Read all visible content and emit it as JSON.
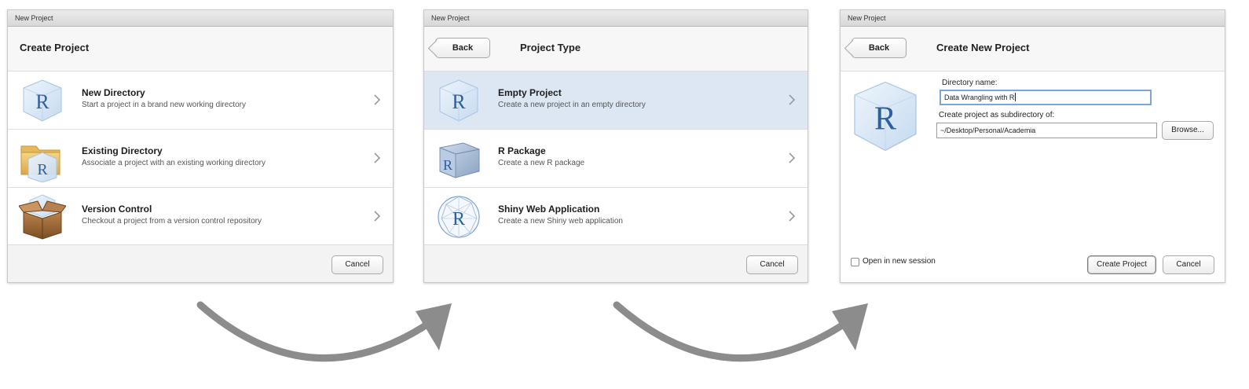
{
  "panel1": {
    "window_title": "New Project",
    "header_title": "Create Project",
    "options": [
      {
        "title": "New Directory",
        "desc": "Start a project in a brand new working directory",
        "icon": "r-cube-icon"
      },
      {
        "title": "Existing Directory",
        "desc": "Associate a project with an existing working directory",
        "icon": "folder-r-icon"
      },
      {
        "title": "Version Control",
        "desc": "Checkout a project from a version control repository",
        "icon": "box-icon"
      }
    ],
    "cancel_label": "Cancel"
  },
  "panel2": {
    "window_title": "New Project",
    "back_label": "Back",
    "header_title": "Project Type",
    "options": [
      {
        "title": "Empty Project",
        "desc": "Create a new project in an empty directory",
        "icon": "r-cube-icon",
        "selected": true
      },
      {
        "title": "R Package",
        "desc": "Create a new R package",
        "icon": "r-package-icon"
      },
      {
        "title": "Shiny Web Application",
        "desc": "Create a new Shiny web application",
        "icon": "shiny-globe-icon"
      }
    ],
    "cancel_label": "Cancel"
  },
  "panel3": {
    "window_title": "New Project",
    "back_label": "Back",
    "header_title": "Create New Project",
    "directory_name_label": "Directory name:",
    "directory_name_value": "Data Wrangling with R",
    "subdirectory_label": "Create project as subdirectory of:",
    "subdirectory_value": "~/Desktop/Personal/Academia",
    "browse_label": "Browse...",
    "open_new_session_label": "Open in new session",
    "open_new_session_checked": false,
    "create_label": "Create Project",
    "cancel_label": "Cancel"
  },
  "colors": {
    "selected_row": "#dce7f3",
    "arrow": "#8c8c8c",
    "r_blue": "#2f5f9c"
  }
}
